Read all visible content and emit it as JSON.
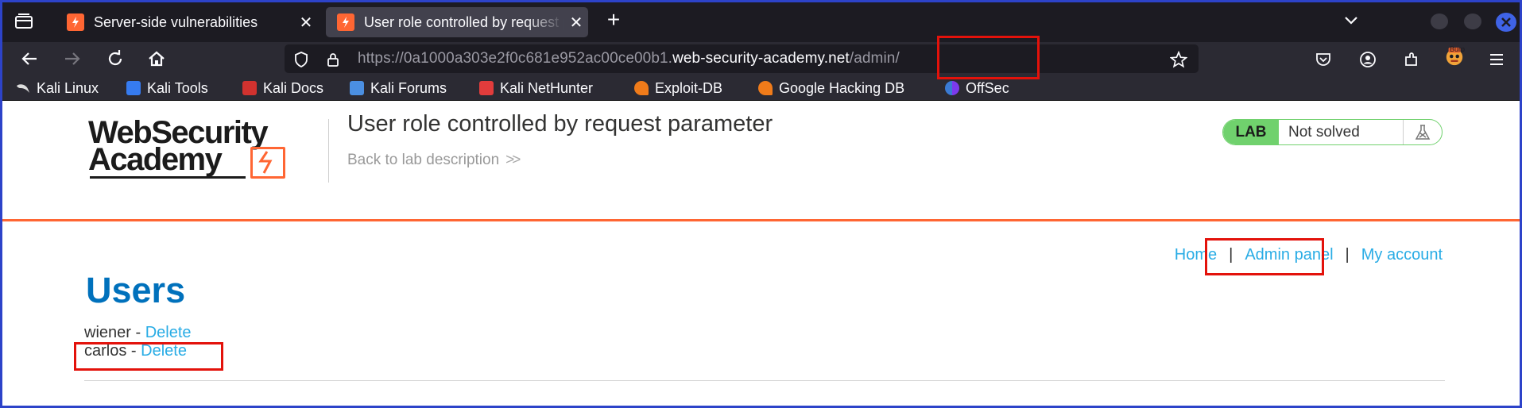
{
  "browser": {
    "tabs": [
      {
        "title": "Server-side vulnerabilities",
        "active": false
      },
      {
        "title": "User role controlled by request parameter",
        "active": true
      }
    ],
    "url": {
      "scheme_prefix": "https://0a1000a303e2f0c681e952ac00ce00b1.",
      "host": "web-security-academy.net",
      "path": "/admin/"
    },
    "bookmarks": [
      {
        "label": "Kali Linux",
        "icon": "kali-dragon-icon"
      },
      {
        "label": "Kali Tools",
        "icon": "kali-tools-icon"
      },
      {
        "label": "Kali Docs",
        "icon": "kali-docs-icon"
      },
      {
        "label": "Kali Forums",
        "icon": "kali-forums-icon"
      },
      {
        "label": "Kali NetHunter",
        "icon": "kali-nethunter-icon"
      },
      {
        "label": "Exploit-DB",
        "icon": "exploit-db-icon"
      },
      {
        "label": "Google Hacking DB",
        "icon": "ghdb-icon"
      },
      {
        "label": "OffSec",
        "icon": "offsec-icon"
      }
    ],
    "extension_badge": "Burp"
  },
  "header": {
    "logo_line1": "WebSecurity",
    "logo_line2": "Academy",
    "lab_title": "User role controlled by request parameter",
    "back_link": "Back to lab description",
    "lab_badge": "LAB",
    "lab_status": "Not solved"
  },
  "nav": {
    "home": "Home",
    "separator": "|",
    "admin_panel": "Admin panel",
    "my_account": "My account"
  },
  "main": {
    "heading": "Users",
    "users": [
      {
        "name": "wiener",
        "dash": " - ",
        "action": "Delete"
      },
      {
        "name": "carlos",
        "dash": " - ",
        "action": "Delete"
      }
    ]
  },
  "colors": {
    "accent_orange": "#ff6633",
    "link_blue": "#29ace5",
    "heading_blue": "#0071bc",
    "lab_green": "#70d16d",
    "highlight_red": "#e3120b"
  }
}
